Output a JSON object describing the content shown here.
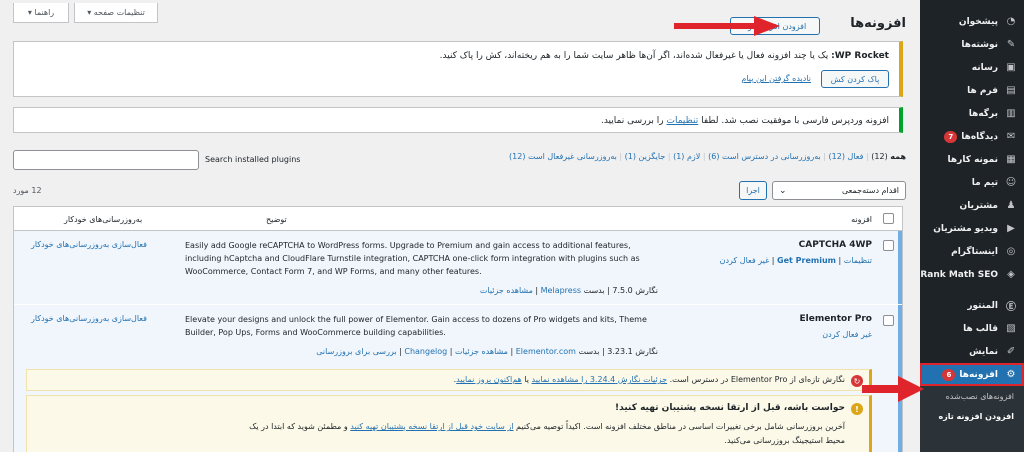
{
  "sidebar": {
    "items": [
      {
        "label": "پیشخوان",
        "icon": "dashboard-icon"
      },
      {
        "label": "نوشته‌ها",
        "icon": "pin-icon"
      },
      {
        "label": "رسانه",
        "icon": "media-icon"
      },
      {
        "label": "فرم ها",
        "icon": "forms-icon"
      },
      {
        "label": "برگه‌ها",
        "icon": "pages-icon"
      },
      {
        "label": "دیدگاه‌ها",
        "icon": "comments-icon",
        "badge": "7"
      },
      {
        "label": "نمونه کارها",
        "icon": "portfolio-icon"
      },
      {
        "label": "تیم ما",
        "icon": "team-icon"
      },
      {
        "label": "مشتریان",
        "icon": "customers-icon"
      },
      {
        "label": "ویدیو مشتریان",
        "icon": "video-icon"
      },
      {
        "label": "اینستاگرام",
        "icon": "instagram-icon"
      },
      {
        "label": "Rank Math SEO",
        "icon": "rankmath-icon"
      },
      {
        "label": "المنتور",
        "icon": "elementor-icon"
      },
      {
        "label": "قالب ها",
        "icon": "templates-icon"
      },
      {
        "label": "نمایش",
        "icon": "appearance-icon"
      },
      {
        "label": "افزونه‌ها",
        "icon": "plugins-icon",
        "badge": "6",
        "active": true
      }
    ],
    "subitems": [
      "افزونه‌های نصب‌شده",
      "افزودن افزونه تازه"
    ]
  },
  "screen_tabs": {
    "screen_options": "تنظیمات صفحه ▾",
    "help": "راهنما ▾"
  },
  "page": {
    "title": "افزونه‌ها",
    "add_new": "افزودن افزونه تازه"
  },
  "wp_rocket_notice": {
    "brand": "WP Rocket:",
    "text": " یک یا چند افزونه فعال یا غیرفعال شده‌اند، اگر آن‌ها ظاهر سایت شما را به هم ریخته‌اند، کش را پاک کنید.",
    "button": "پاک کردن کش",
    "dismiss": "نادیده گرفتن این پیام"
  },
  "persian_notice": {
    "text": "افزونه وردپرس فارسی با موفقیت نصب شد. لطفا ",
    "link": "تنظیمات",
    "text_after": " را بررسی نمایید."
  },
  "filters": {
    "all": "همه",
    "all_count": "(12)",
    "items": [
      "فعال (12)",
      "به‌روزرسانی در دسترس است (6)",
      "لازم (1)",
      "جایگزین (1)",
      "به‌روزرسانی غیرفعال است (12)"
    ]
  },
  "search": {
    "label": "Search installed plugins",
    "placeholder": ""
  },
  "bulk": {
    "select": "اقدام دسته‌جمعی",
    "apply": "اجرا",
    "count": "12 مورد"
  },
  "table": {
    "headers": {
      "plugin": "افزونه",
      "description": "توضیح",
      "auto_updates": "به‌روزرسانی‌های خودکار"
    },
    "rows": [
      {
        "name": "CAPTCHA 4WP",
        "actions": [
          "تنظیمات",
          "Get Premium",
          "غیر فعال کردن"
        ],
        "description": "Easily add Google reCAPTCHA to WordPress forms. Upgrade to Premium and gain access to additional features, including hCaptcha and CloudFlare Turnstile integration, CAPTCHA one-click form integration with plugins such as WooCommerce, Contact Form 7, and WP Forms, and many other features.",
        "version": "نگارش 7.5.0",
        "by": "| بدست",
        "author": "Melapress",
        "details": "مشاهده جزئیات",
        "auto_update": "فعال‌سازی به‌روزرسانی‌های خودکار"
      },
      {
        "name": "Elementor Pro",
        "actions": [
          "غیر فعال کردن"
        ],
        "description": "Elevate your designs and unlock the full power of Elementor. Gain access to dozens of Pro widgets and kits, Theme Builder, Pop Ups, Forms and WooCommerce building capabilities.",
        "version": "نگارش 3.23.1",
        "by": "| بدست",
        "author": "Elementor.com",
        "details": "مشاهده جزئیات",
        "changelog": "Changelog",
        "check_updates": "بررسی برای بروزرسانی",
        "auto_update": "فعال‌سازی به‌روزرسانی‌های خودکار"
      }
    ]
  },
  "update_notice": {
    "text": "نگارش تازه‌ای از Elementor Pro در دسترس است. ",
    "link1": "جزئیات نگارش 3.24.4 را مشاهده نمایید",
    "or": " یا ",
    "link2": "هم‌اکنون بروز نمایید",
    "end": "."
  },
  "backup_notice": {
    "title": "حواست باشه، قبل از ارتقا نسخه پشتیبان تهیه کنید!",
    "line1": "آخرین بروزرسانی شامل برخی تغییرات اساسی در مناطق مختلف افزونه است. اکیداً توصیه می‌کنیم ",
    "link1": "از سایت خود قبل از ارتقا نسخه پشتیبان تهیه کنید",
    "line1b": " و مطمئن شوید که ابتدا در یک",
    "line2": "محیط استیجینگ بروزرسانی می‌کنید."
  }
}
